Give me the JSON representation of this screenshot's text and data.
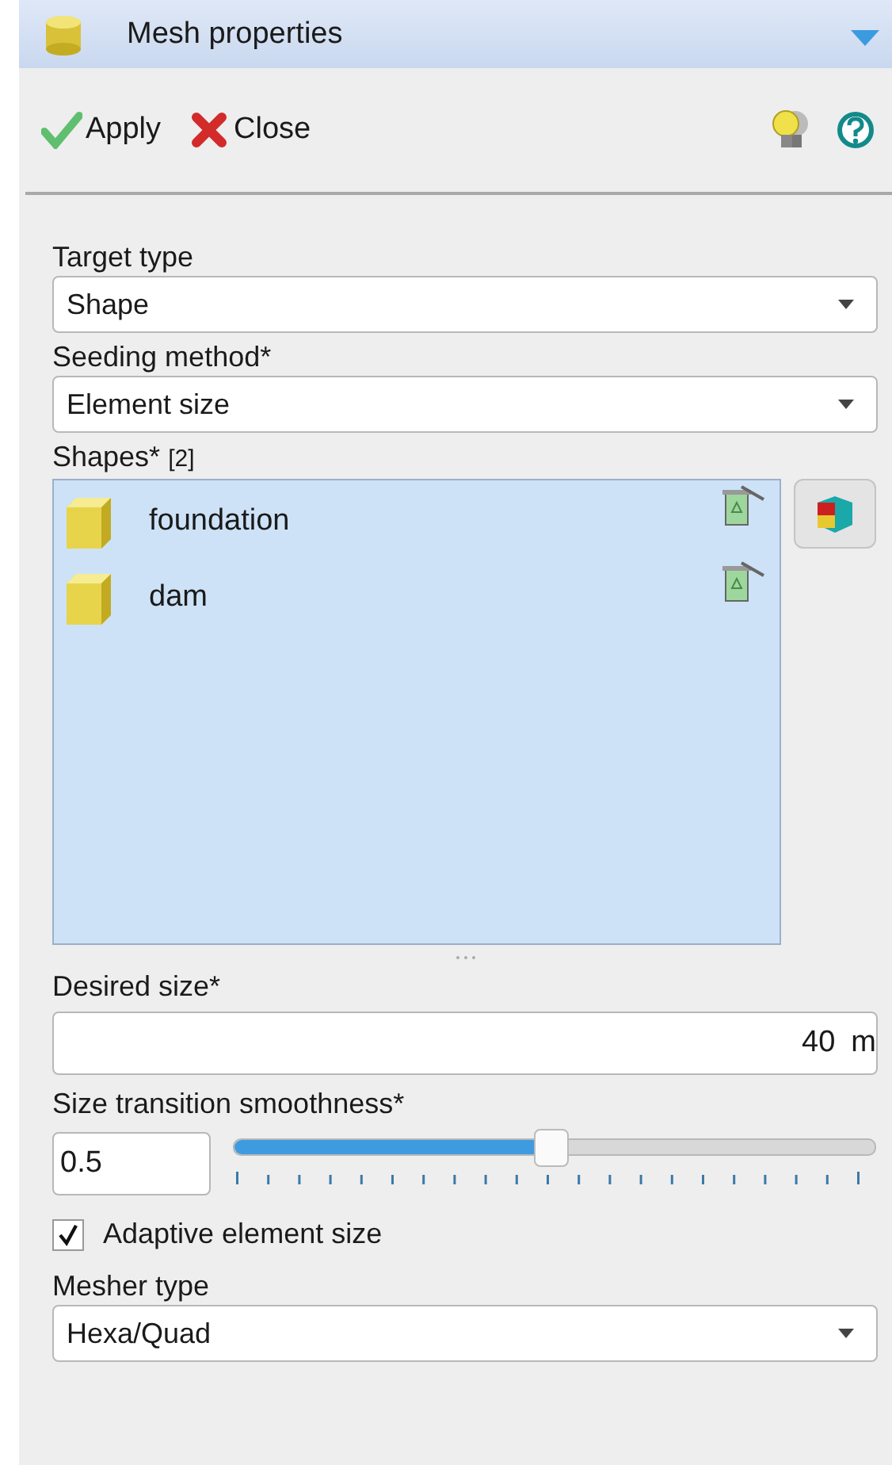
{
  "panel": {
    "title": "Mesh properties",
    "expanded": true
  },
  "toolbar": {
    "buttons": [
      {
        "label": "Apply",
        "kind": "apply"
      },
      {
        "label": "Close",
        "kind": "close"
      }
    ]
  },
  "target_type": {
    "label": "Target type",
    "value": "Shape"
  },
  "seeding_method": {
    "label": "Seeding method*",
    "value": "Element size"
  },
  "shapes": {
    "label": "Shapes*",
    "count": "[2]",
    "items": [
      {
        "name": "foundation"
      },
      {
        "name": "dam"
      }
    ]
  },
  "desired_size": {
    "label": "Desired size*",
    "value": "40",
    "unit": "m"
  },
  "smoothness": {
    "label": "Size transition smoothness*",
    "value": "0.5",
    "level": 0.5
  },
  "adaptive": {
    "label": "Adaptive element size",
    "checked": true
  },
  "mesher_type": {
    "label": "Mesher type",
    "value": "Hexa/Quad"
  }
}
